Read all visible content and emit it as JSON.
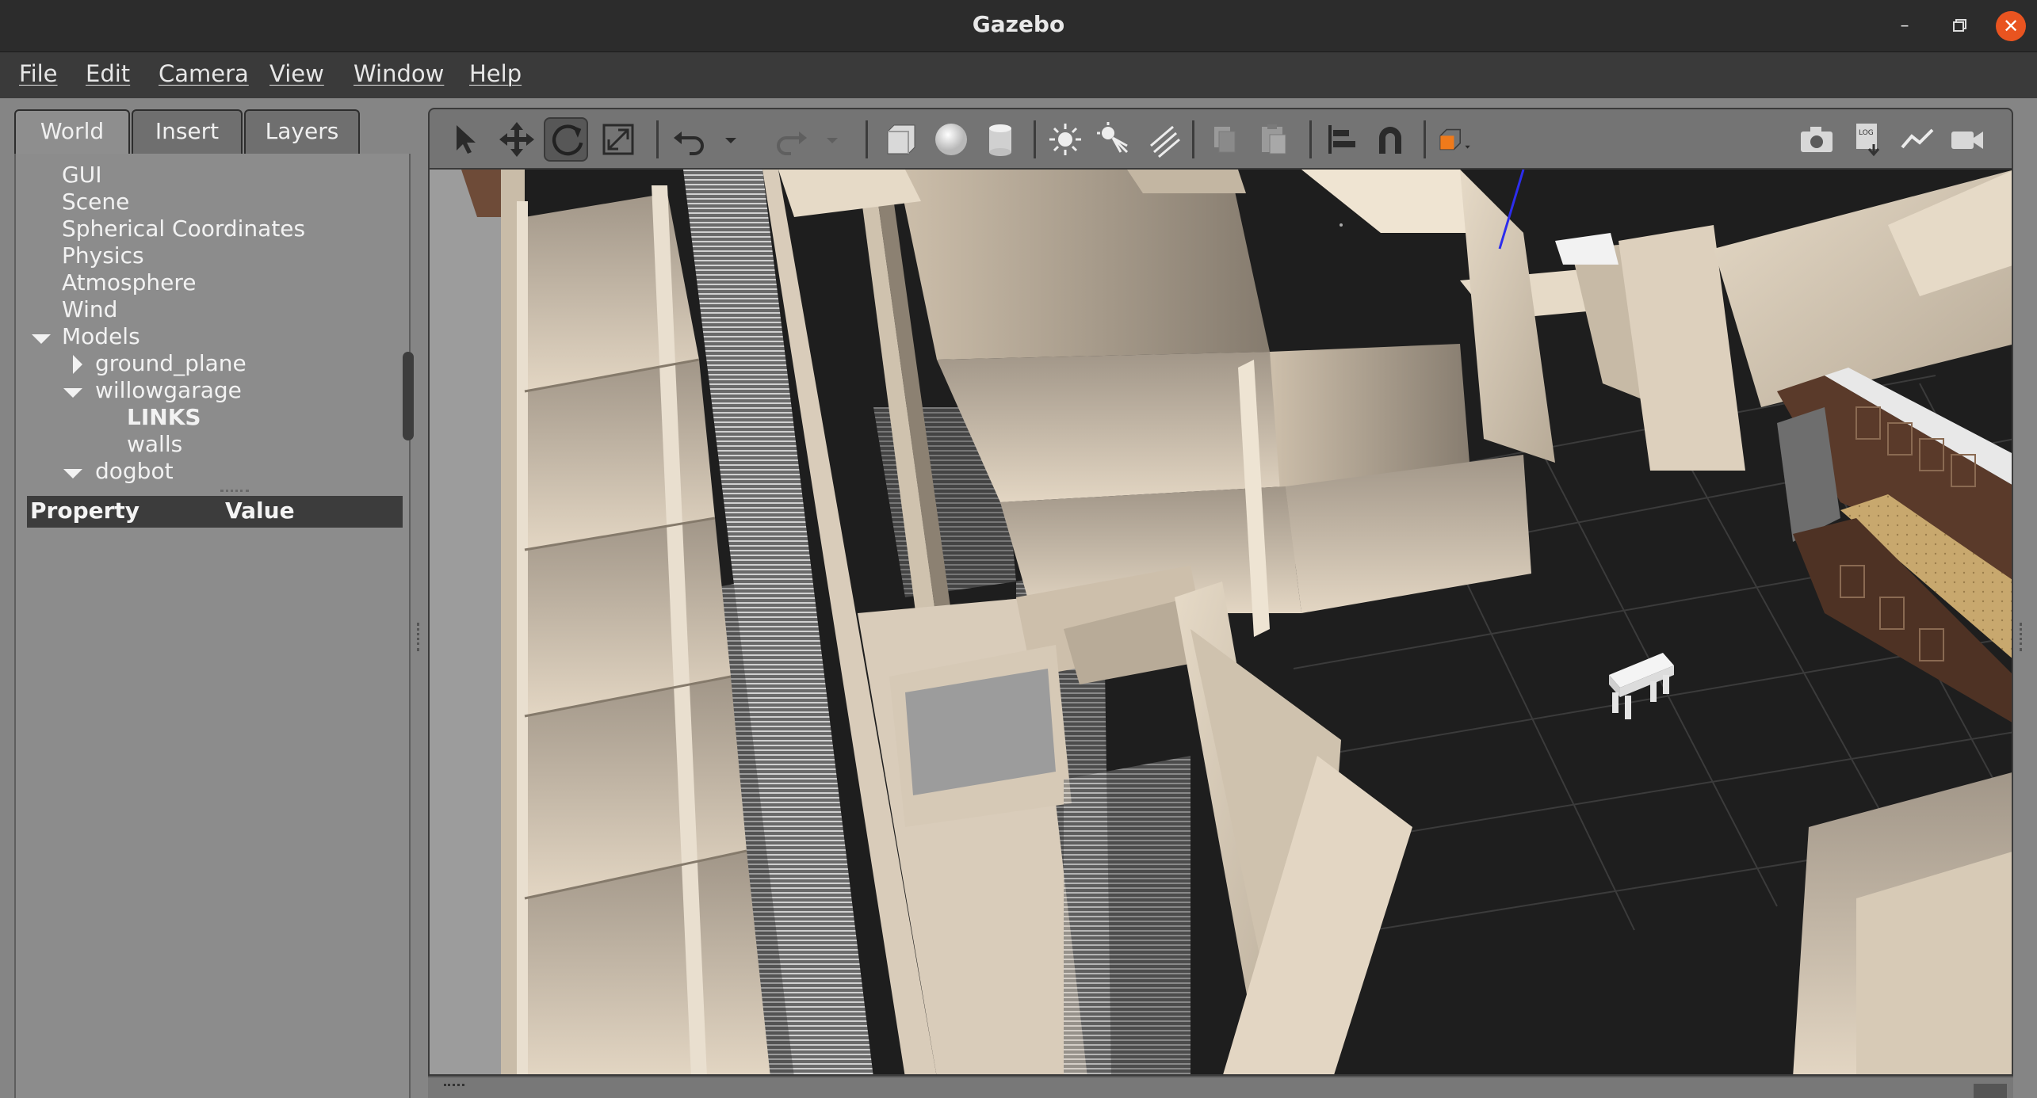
{
  "window": {
    "title": "Gazebo",
    "minimize_glyph": "–",
    "maximize_glyph": "▫",
    "close_glyph": "✕"
  },
  "menubar": {
    "items": [
      {
        "label": "File"
      },
      {
        "label": "Edit"
      },
      {
        "label": "Camera"
      },
      {
        "label": "View"
      },
      {
        "label": "Window"
      },
      {
        "label": "Help"
      }
    ]
  },
  "left_panel": {
    "tabs": [
      {
        "label": "World",
        "active": true
      },
      {
        "label": "Insert",
        "active": false
      },
      {
        "label": "Layers",
        "active": false
      }
    ],
    "tree": {
      "gui": "GUI",
      "scene": "Scene",
      "spherical": "Spherical Coordinates",
      "physics": "Physics",
      "atmosphere": "Atmosphere",
      "wind": "Wind",
      "models": "Models",
      "ground_plane": "ground_plane",
      "willowgarage": "willowgarage",
      "links": "LINKS",
      "walls": "walls",
      "dogbot": "dogbot"
    },
    "properties": {
      "col_property": "Property",
      "col_value": "Value"
    }
  },
  "toolbar": {
    "icons": [
      "select-arrow-icon",
      "translate-icon",
      "rotate-icon",
      "scale-icon",
      "undo-icon",
      "undo-dropdown-icon",
      "redo-icon",
      "redo-dropdown-icon",
      "box-shape-icon",
      "sphere-shape-icon",
      "cylinder-shape-icon",
      "point-light-icon",
      "spot-light-icon",
      "directional-light-icon",
      "copy-icon",
      "paste-icon",
      "align-icon",
      "snap-magnet-icon",
      "view-angle-icon",
      "screenshot-camera-icon",
      "log-icon",
      "plot-icon",
      "video-record-icon"
    ],
    "active_tool": "rotate-icon"
  },
  "colors": {
    "titlebar": "#2c2c2c",
    "menubar": "#3a3a3a",
    "panel": "#8c8c8c",
    "toolbar": "#747474",
    "close_button": "#e95420",
    "viewport_floor": "#1e1e1e",
    "wall_color": "#d8ccbb"
  }
}
